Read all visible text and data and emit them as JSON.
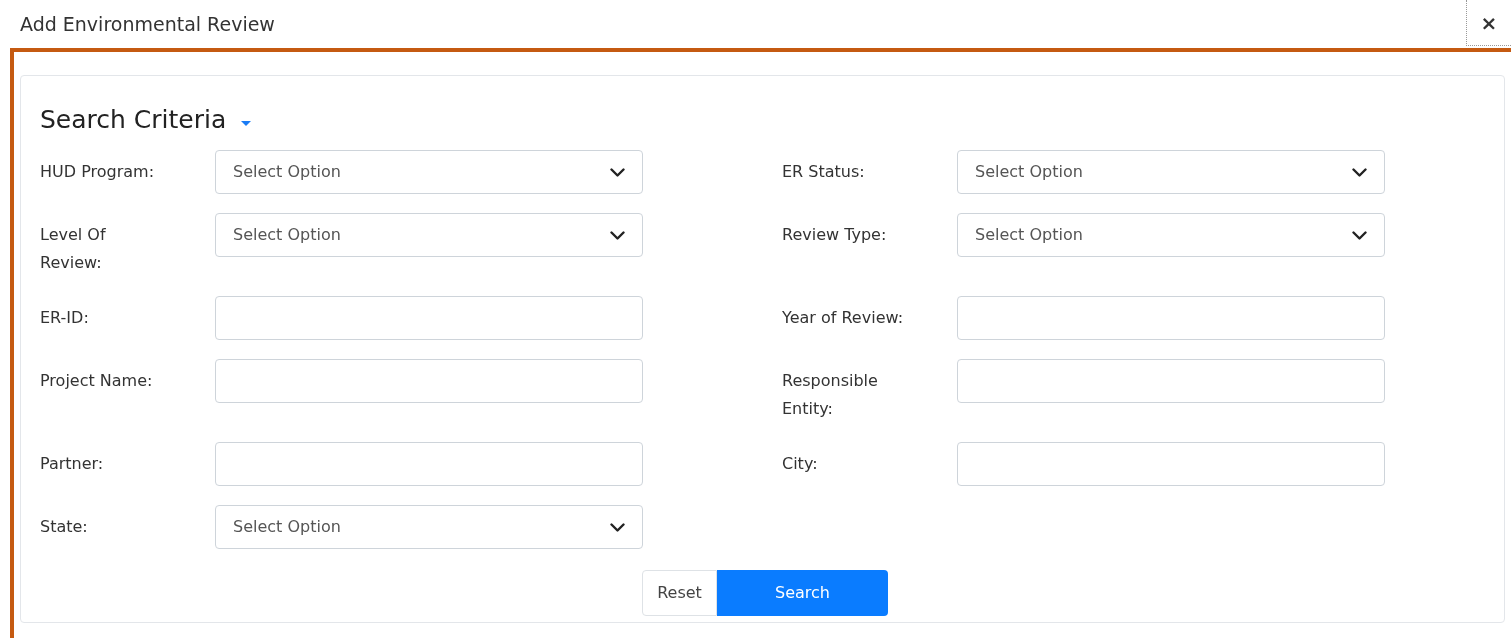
{
  "window": {
    "title": "Add Environmental Review",
    "close": "×"
  },
  "section": {
    "title": "Search Criteria",
    "expanded": true
  },
  "fields": [
    {
      "label": "HUD Program:",
      "kind": "select",
      "value": "Select Option"
    },
    {
      "label": "ER Status:",
      "kind": "select",
      "value": "Select Option"
    },
    {
      "label": "Level Of Review:",
      "kind": "select",
      "value": "Select Option"
    },
    {
      "label": "Review Type:",
      "kind": "select",
      "value": "Select Option"
    },
    {
      "label": "ER-ID:",
      "kind": "text"
    },
    {
      "label": "Year of Review:",
      "kind": "text"
    },
    {
      "label": "Project Name:",
      "kind": "text"
    },
    {
      "label": "Responsible Entity:",
      "kind": "text"
    },
    {
      "label": "Partner:",
      "kind": "text"
    },
    {
      "label": "City:",
      "kind": "text"
    },
    {
      "label": "State:",
      "kind": "select",
      "value": "Select Option"
    }
  ],
  "buttons": [
    {
      "label": "Reset",
      "kind": "secondary"
    },
    {
      "label": "Search",
      "kind": "primary"
    }
  ]
}
